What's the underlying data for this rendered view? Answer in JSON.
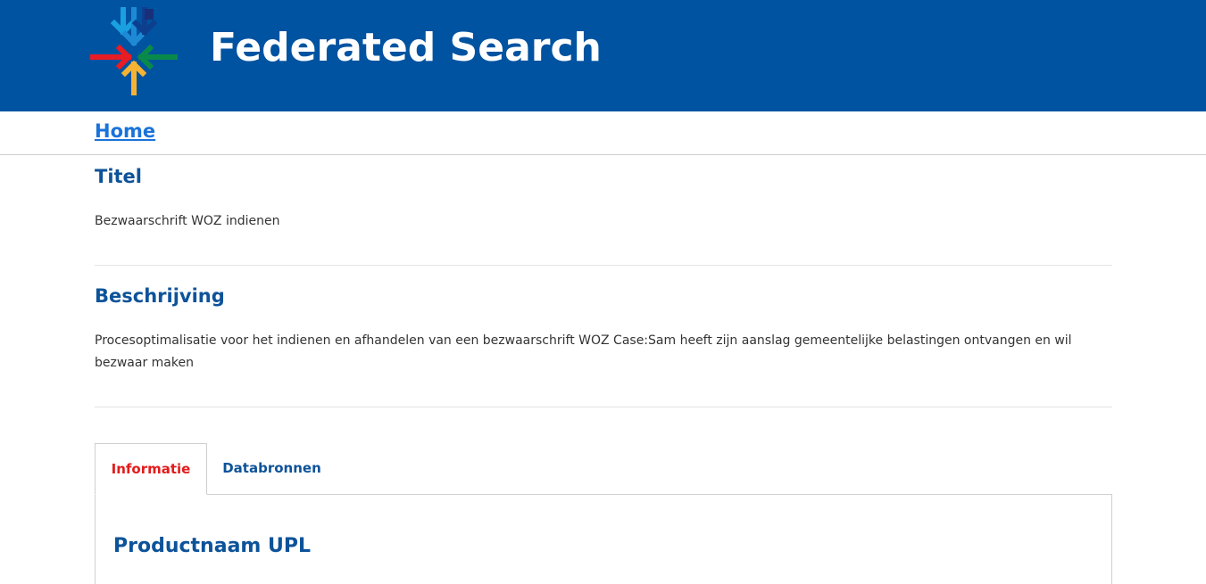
{
  "header": {
    "title": "Federated Search",
    "logo_icon": "converging-arrows-logo",
    "background_color": "#0053a0"
  },
  "nav": {
    "home_label": "Home"
  },
  "sections": {
    "titel": {
      "heading": "Titel",
      "text": "Bezwaarschrift WOZ indienen"
    },
    "beschrijving": {
      "heading": "Beschrijving",
      "text": "Procesoptimalisatie voor het indienen en afhandelen van een bezwaarschrift WOZ Case:Sam heeft zijn aanslag gemeentelijke belastingen ontvangen en wil bezwaar maken"
    }
  },
  "tabs": [
    {
      "label": "Informatie",
      "active": true
    },
    {
      "label": "Databronnen",
      "active": false
    }
  ],
  "panel": {
    "heading": "Productnaam UPL"
  },
  "colors": {
    "heading_blue": "#0d5399",
    "link_blue": "#1a73d9",
    "active_tab_red": "#e31b1b"
  }
}
